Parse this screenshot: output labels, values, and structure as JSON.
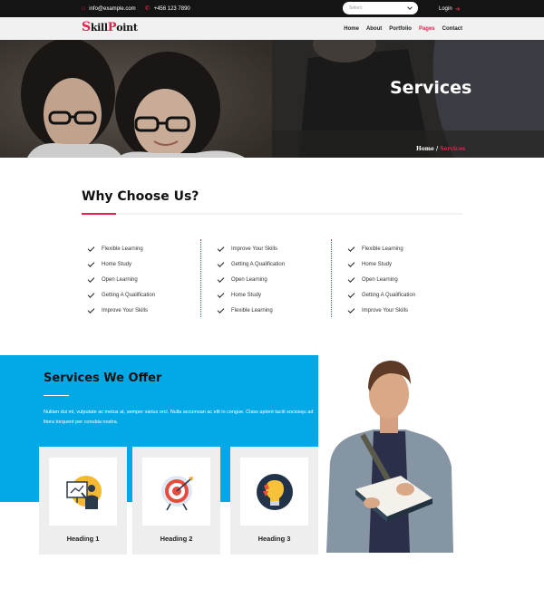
{
  "topbar": {
    "email": "info@example.com",
    "phone": "+456 123 7890",
    "select_placeholder": "Select",
    "login_label": "Login"
  },
  "brand": {
    "logo_s": "S",
    "logo_mid": "kill",
    "logo_p": "P",
    "logo_end": "oint"
  },
  "nav": {
    "items": [
      {
        "label": "Home"
      },
      {
        "label": "About"
      },
      {
        "label": "Portfolio"
      },
      {
        "label": "Pages"
      },
      {
        "label": "Contact"
      }
    ],
    "active": "Pages"
  },
  "hero": {
    "title": "Services",
    "breadcrumb_home": "Home",
    "breadcrumb_sep": "/",
    "breadcrumb_current": "Services"
  },
  "why": {
    "title": "Why Choose Us?",
    "columns": [
      [
        "Flexible Learning",
        "Home Study",
        "Open Learning",
        "Getting A Qualification",
        "Improve Your Skills"
      ],
      [
        "Improve Your Skills",
        "Getting A Qualification",
        "Open Learning",
        "Home Study",
        "Flexible Learning"
      ],
      [
        "Flexible Learning",
        "Home Study",
        "Open Learning",
        "Getting A Qualification",
        "Improve Your Skills"
      ]
    ]
  },
  "services": {
    "title": "Services We Offer",
    "description": "Nullam dui mi, vulputate ac metus at, semper varius orci. Nulla accumsan ac elit in congue. Class aptent taciti sociosqu ad litora torquent per conubia nostra.",
    "cards": [
      {
        "heading": "Heading 1",
        "icon": "presentation-icon"
      },
      {
        "heading": "Heading 2",
        "icon": "target-icon"
      },
      {
        "heading": "Heading 3",
        "icon": "lightbulb-icon"
      }
    ]
  },
  "colors": {
    "accent": "#e8214f",
    "blue_band": "#03a9e6",
    "topbar": "#141414"
  }
}
